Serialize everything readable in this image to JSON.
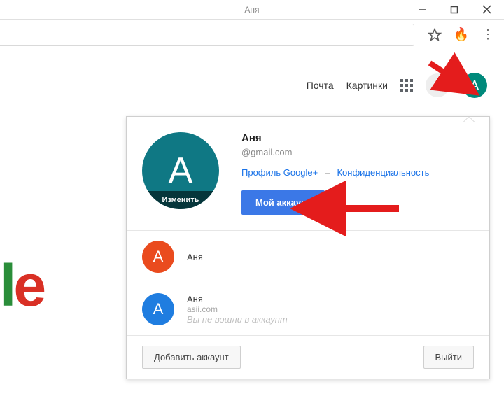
{
  "window": {
    "title": "Аня"
  },
  "header": {
    "mail": "Почта",
    "images": "Картинки",
    "avatar_letter": "А"
  },
  "logo": {
    "l": "l",
    "e": "e"
  },
  "popover": {
    "name": "Аня",
    "email": "@gmail.com",
    "avatar_letter": "А",
    "edit_label": "Изменить",
    "profile_link": "Профиль Google+",
    "privacy_link": "Конфиденциальность",
    "my_account_label": "Мой аккаунт",
    "accounts": [
      {
        "letter": "А",
        "name": "Аня",
        "email": "",
        "color": "orange"
      },
      {
        "letter": "А",
        "name": "Аня",
        "email": "asii.com",
        "note": "Вы не вошли в аккаунт",
        "color": "blue"
      }
    ],
    "add_account_label": "Добавить аккаунт",
    "signout_label": "Выйти"
  }
}
